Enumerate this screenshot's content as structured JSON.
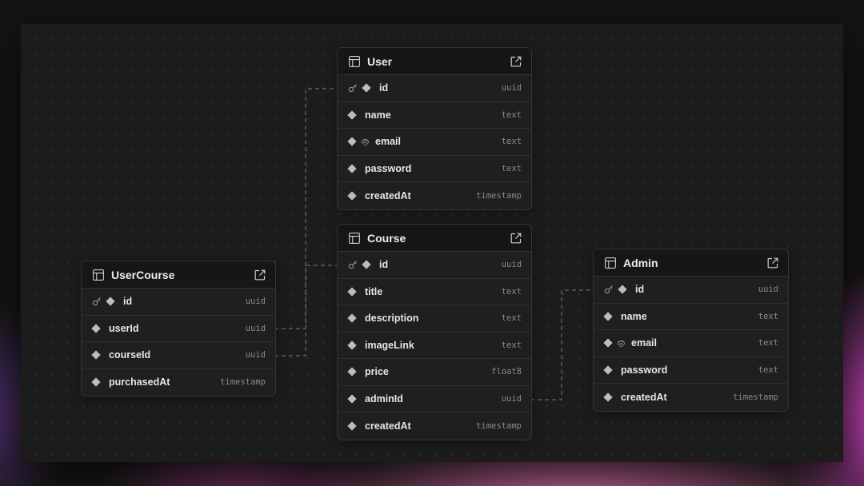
{
  "tables": {
    "user": {
      "name": "User",
      "columns": [
        {
          "name": "id",
          "type": "uuid"
        },
        {
          "name": "name",
          "type": "text"
        },
        {
          "name": "email",
          "type": "text"
        },
        {
          "name": "password",
          "type": "text"
        },
        {
          "name": "createdAt",
          "type": "timestamp"
        }
      ]
    },
    "course": {
      "name": "Course",
      "columns": [
        {
          "name": "id",
          "type": "uuid"
        },
        {
          "name": "title",
          "type": "text"
        },
        {
          "name": "description",
          "type": "text"
        },
        {
          "name": "imageLink",
          "type": "text"
        },
        {
          "name": "price",
          "type": "float8"
        },
        {
          "name": "adminId",
          "type": "uuid"
        },
        {
          "name": "createdAt",
          "type": "timestamp"
        }
      ]
    },
    "usercourse": {
      "name": "UserCourse",
      "columns": [
        {
          "name": "id",
          "type": "uuid"
        },
        {
          "name": "userId",
          "type": "uuid"
        },
        {
          "name": "courseId",
          "type": "uuid"
        },
        {
          "name": "purchasedAt",
          "type": "timestamp"
        }
      ]
    },
    "admin": {
      "name": "Admin",
      "columns": [
        {
          "name": "id",
          "type": "uuid"
        },
        {
          "name": "name",
          "type": "text"
        },
        {
          "name": "email",
          "type": "text"
        },
        {
          "name": "password",
          "type": "text"
        },
        {
          "name": "createdAt",
          "type": "timestamp"
        }
      ]
    }
  },
  "relationships": [
    {
      "from": "UserCourse.userId",
      "to": "User.id"
    },
    {
      "from": "UserCourse.courseId",
      "to": "Course.id"
    },
    {
      "from": "Course.adminId",
      "to": "Admin.id"
    }
  ],
  "icons": {
    "table": "table-grid-icon",
    "open": "external-link-icon",
    "primary_key": "key-icon",
    "column": "diamond-icon",
    "unique": "fingerprint-icon"
  },
  "colors": {
    "background": "#141414",
    "canvas": "#1c1c1c",
    "card": "#1f1f1f",
    "header": "#161616",
    "border": "#343434",
    "connector": "#6a6a6a"
  }
}
